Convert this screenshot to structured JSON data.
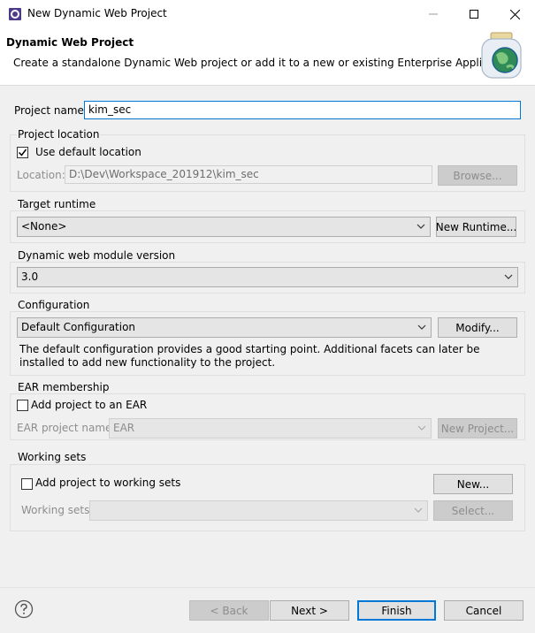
{
  "window": {
    "title": "New Dynamic Web Project",
    "icon": "eclipse-app-icon"
  },
  "banner": {
    "title": "Dynamic Web Project",
    "description": "Create a standalone Dynamic Web project or add it to a new or existing Enterprise Application.",
    "icon": "globe-jar-icon"
  },
  "project": {
    "name_label": "Project name:",
    "name_value": "kim_sec"
  },
  "location": {
    "group_title": "Project location",
    "use_default_label": "Use default location",
    "use_default_checked": true,
    "location_label": "Location:",
    "location_value": "D:\\Dev\\Workspace_201912\\kim_sec",
    "browse_label": "Browse..."
  },
  "runtime": {
    "group_title": "Target runtime",
    "selected": "<None>",
    "new_runtime_label": "New Runtime..."
  },
  "module": {
    "group_title": "Dynamic web module version",
    "selected": "3.0"
  },
  "configuration": {
    "group_title": "Configuration",
    "selected": "Default Configuration",
    "modify_label": "Modify...",
    "description": "The default configuration provides a good starting point. Additional facets can later be installed to add new functionality to the project."
  },
  "ear": {
    "group_title": "EAR membership",
    "add_label": "Add project to an EAR",
    "add_checked": false,
    "project_name_label": "EAR project name:",
    "project_name_value": "EAR",
    "new_project_label": "New Project..."
  },
  "working_sets": {
    "group_title": "Working sets",
    "add_label": "Add project to working sets",
    "add_checked": false,
    "new_label": "New...",
    "working_sets_label": "Working sets:",
    "working_sets_value": "",
    "select_label": "Select..."
  },
  "footer": {
    "back_label": "< Back",
    "next_label": "Next >",
    "finish_label": "Finish",
    "cancel_label": "Cancel"
  },
  "colors": {
    "accent": "#0078d7",
    "dialog_bg": "#f0f0f0",
    "banner_bg": "#ffffff",
    "disabled_text": "#8d8d8d"
  }
}
